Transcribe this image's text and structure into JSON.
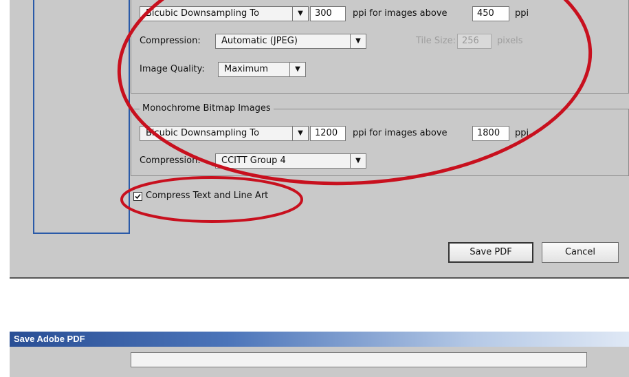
{
  "color_image_section": {
    "downsampling_method": "Bicubic Downsampling To",
    "ppi_value": "300",
    "ppi_label": "ppi for images above",
    "above_value": "450",
    "above_unit": "ppi",
    "compression_label": "Compression:",
    "compression_value": "Automatic (JPEG)",
    "tile_size_label": "Tile Size:",
    "tile_size_value": "256",
    "tile_size_unit": "pixels",
    "quality_label": "Image Quality:",
    "quality_value": "Maximum"
  },
  "mono_section": {
    "title": "Monochrome Bitmap Images",
    "downsampling_method": "Bicubic Downsampling To",
    "ppi_value": "1200",
    "ppi_label": "ppi for images above",
    "above_value": "1800",
    "above_unit": "ppi",
    "compression_label": "Compression:",
    "compression_value": "CCITT Group 4"
  },
  "compress_text_label": "Compress Text and Line Art",
  "buttons": {
    "save": "Save PDF",
    "cancel": "Cancel"
  },
  "second_dialog": {
    "title": "Save Adobe PDF"
  },
  "colors": {
    "dialog_bg": "#c9c9c9",
    "annotation": "#c8101e",
    "title_bar": "#2a4f95"
  }
}
